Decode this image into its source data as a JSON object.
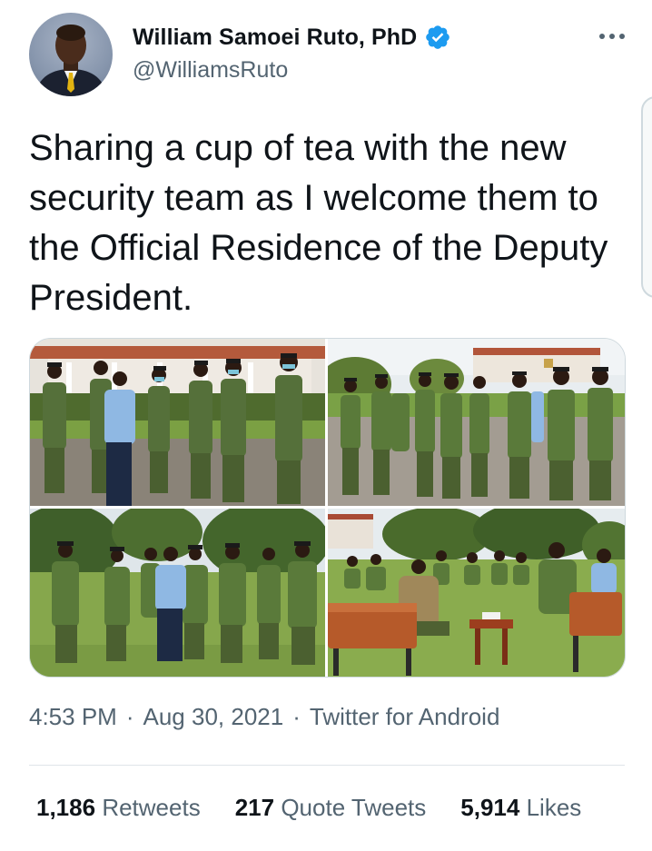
{
  "author": {
    "display_name": "William Samoei Ruto, PhD",
    "handle": "@WilliamsRuto",
    "verified": true,
    "avatar_icon": "profile-photo"
  },
  "tweet": {
    "text": "Sharing a cup of tea with the new security team as I welcome them to the Official Residence of the Deputy President.",
    "photo_count": 4
  },
  "meta": {
    "time": "4:53 PM",
    "date": "Aug 30, 2021",
    "separator": "·",
    "source": "Twitter for Android"
  },
  "stats": {
    "retweets_count": "1,186",
    "retweets_label": "Retweets",
    "quotes_count": "217",
    "quotes_label": "Quote Tweets",
    "likes_count": "5,914",
    "likes_label": "Likes"
  },
  "colors": {
    "primary_text": "#0f1419",
    "secondary_text": "#536471",
    "verified_blue": "#1d9bf0",
    "border": "#cfd9de",
    "uniform_green": "#5b7a3c",
    "grass_green": "#6b8f3a"
  }
}
